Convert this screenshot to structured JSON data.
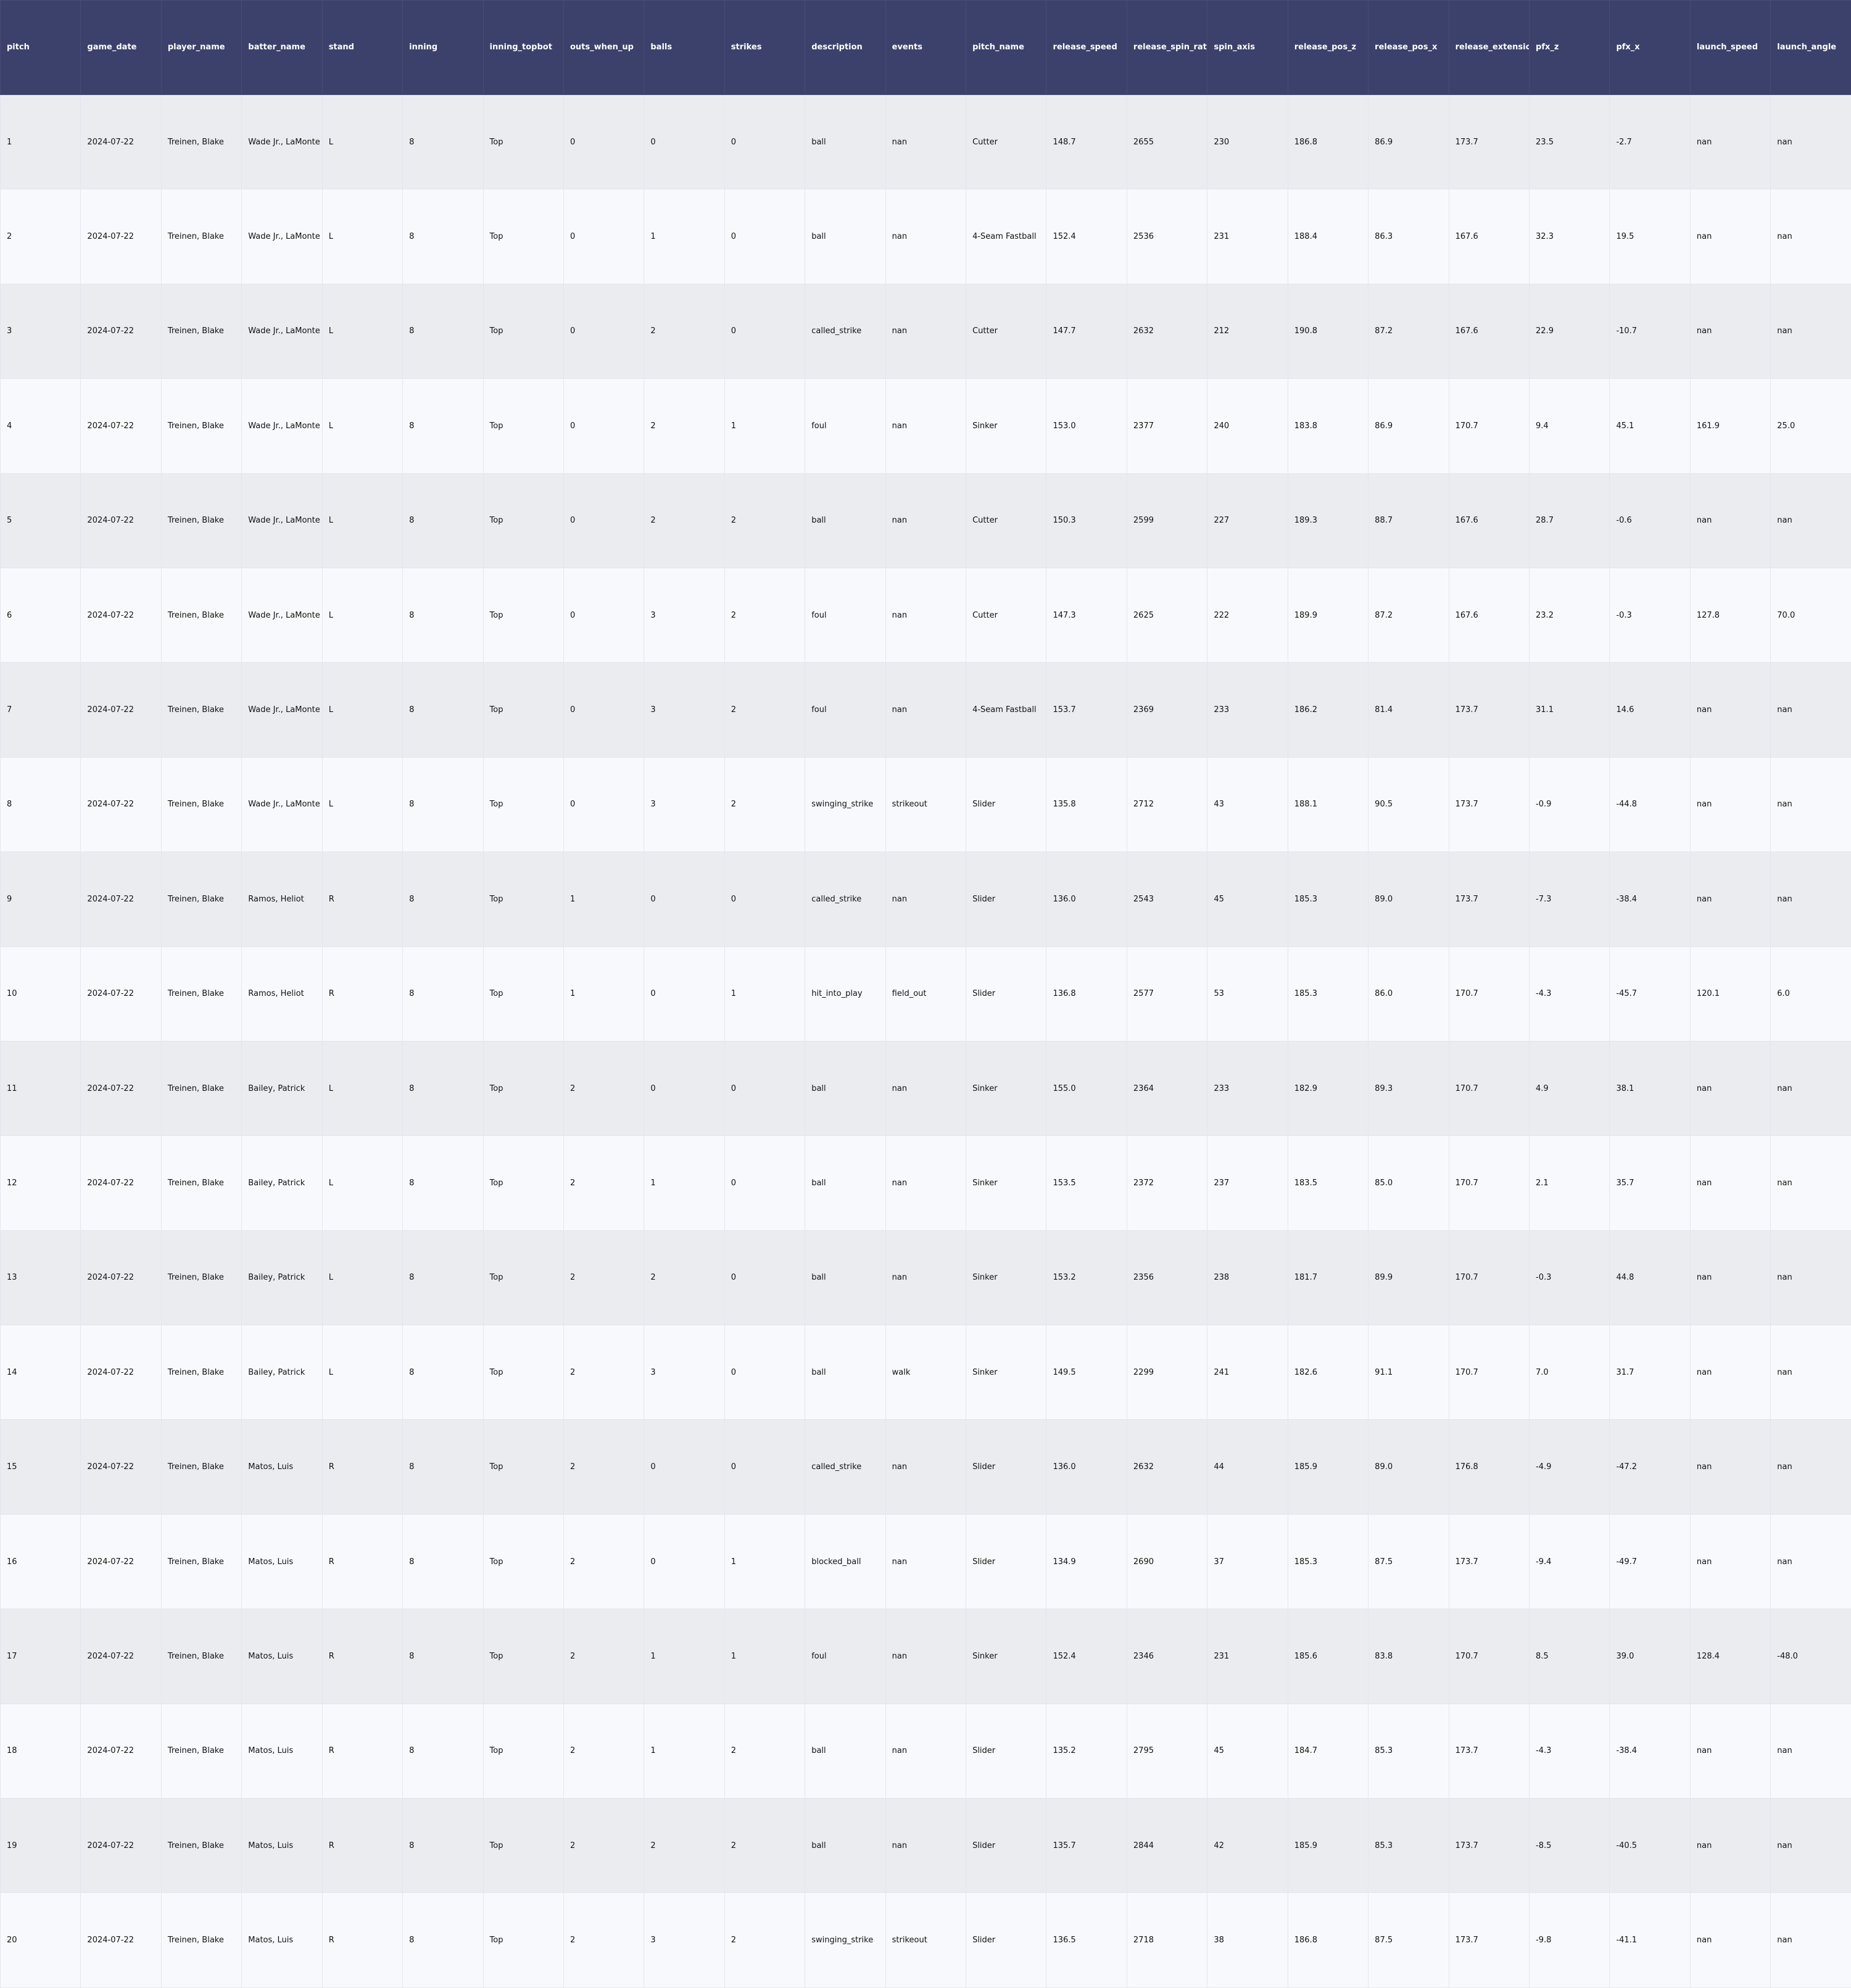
{
  "chart_data": {
    "type": "table",
    "columns": [
      "pitch",
      "game_date",
      "player_name",
      "batter_name",
      "stand",
      "inning",
      "inning_topbot",
      "outs_when_up",
      "balls",
      "strikes",
      "description",
      "events",
      "pitch_name",
      "release_speed",
      "release_spin_rate",
      "spin_axis",
      "release_pos_z",
      "release_pos_x",
      "release_extension",
      "pfx_z",
      "pfx_x",
      "launch_speed",
      "launch_angle"
    ],
    "rows": [
      [
        "1",
        "2024-07-22",
        "Treinen, Blake",
        "Wade Jr., LaMonte",
        "L",
        "8",
        "Top",
        "0",
        "0",
        "0",
        "ball",
        "nan",
        "Cutter",
        "148.7",
        "2655",
        "230",
        "186.8",
        "86.9",
        "173.7",
        "23.5",
        "-2.7",
        "nan",
        "nan"
      ],
      [
        "2",
        "2024-07-22",
        "Treinen, Blake",
        "Wade Jr., LaMonte",
        "L",
        "8",
        "Top",
        "0",
        "1",
        "0",
        "ball",
        "nan",
        "4-Seam Fastball",
        "152.4",
        "2536",
        "231",
        "188.4",
        "86.3",
        "167.6",
        "32.3",
        "19.5",
        "nan",
        "nan"
      ],
      [
        "3",
        "2024-07-22",
        "Treinen, Blake",
        "Wade Jr., LaMonte",
        "L",
        "8",
        "Top",
        "0",
        "2",
        "0",
        "called_strike",
        "nan",
        "Cutter",
        "147.7",
        "2632",
        "212",
        "190.8",
        "87.2",
        "167.6",
        "22.9",
        "-10.7",
        "nan",
        "nan"
      ],
      [
        "4",
        "2024-07-22",
        "Treinen, Blake",
        "Wade Jr., LaMonte",
        "L",
        "8",
        "Top",
        "0",
        "2",
        "1",
        "foul",
        "nan",
        "Sinker",
        "153.0",
        "2377",
        "240",
        "183.8",
        "86.9",
        "170.7",
        "9.4",
        "45.1",
        "161.9",
        "25.0"
      ],
      [
        "5",
        "2024-07-22",
        "Treinen, Blake",
        "Wade Jr., LaMonte",
        "L",
        "8",
        "Top",
        "0",
        "2",
        "2",
        "ball",
        "nan",
        "Cutter",
        "150.3",
        "2599",
        "227",
        "189.3",
        "88.7",
        "167.6",
        "28.7",
        "-0.6",
        "nan",
        "nan"
      ],
      [
        "6",
        "2024-07-22",
        "Treinen, Blake",
        "Wade Jr., LaMonte",
        "L",
        "8",
        "Top",
        "0",
        "3",
        "2",
        "foul",
        "nan",
        "Cutter",
        "147.3",
        "2625",
        "222",
        "189.9",
        "87.2",
        "167.6",
        "23.2",
        "-0.3",
        "127.8",
        "70.0"
      ],
      [
        "7",
        "2024-07-22",
        "Treinen, Blake",
        "Wade Jr., LaMonte",
        "L",
        "8",
        "Top",
        "0",
        "3",
        "2",
        "foul",
        "nan",
        "4-Seam Fastball",
        "153.7",
        "2369",
        "233",
        "186.2",
        "81.4",
        "173.7",
        "31.1",
        "14.6",
        "nan",
        "nan"
      ],
      [
        "8",
        "2024-07-22",
        "Treinen, Blake",
        "Wade Jr., LaMonte",
        "L",
        "8",
        "Top",
        "0",
        "3",
        "2",
        "swinging_strike",
        "strikeout",
        "Slider",
        "135.8",
        "2712",
        "43",
        "188.1",
        "90.5",
        "173.7",
        "-0.9",
        "-44.8",
        "nan",
        "nan"
      ],
      [
        "9",
        "2024-07-22",
        "Treinen, Blake",
        "Ramos, Heliot",
        "R",
        "8",
        "Top",
        "1",
        "0",
        "0",
        "called_strike",
        "nan",
        "Slider",
        "136.0",
        "2543",
        "45",
        "185.3",
        "89.0",
        "173.7",
        "-7.3",
        "-38.4",
        "nan",
        "nan"
      ],
      [
        "10",
        "2024-07-22",
        "Treinen, Blake",
        "Ramos, Heliot",
        "R",
        "8",
        "Top",
        "1",
        "0",
        "1",
        "hit_into_play",
        "field_out",
        "Slider",
        "136.8",
        "2577",
        "53",
        "185.3",
        "86.0",
        "170.7",
        "-4.3",
        "-45.7",
        "120.1",
        "6.0"
      ],
      [
        "11",
        "2024-07-22",
        "Treinen, Blake",
        "Bailey, Patrick",
        "L",
        "8",
        "Top",
        "2",
        "0",
        "0",
        "ball",
        "nan",
        "Sinker",
        "155.0",
        "2364",
        "233",
        "182.9",
        "89.3",
        "170.7",
        "4.9",
        "38.1",
        "nan",
        "nan"
      ],
      [
        "12",
        "2024-07-22",
        "Treinen, Blake",
        "Bailey, Patrick",
        "L",
        "8",
        "Top",
        "2",
        "1",
        "0",
        "ball",
        "nan",
        "Sinker",
        "153.5",
        "2372",
        "237",
        "183.5",
        "85.0",
        "170.7",
        "2.1",
        "35.7",
        "nan",
        "nan"
      ],
      [
        "13",
        "2024-07-22",
        "Treinen, Blake",
        "Bailey, Patrick",
        "L",
        "8",
        "Top",
        "2",
        "2",
        "0",
        "ball",
        "nan",
        "Sinker",
        "153.2",
        "2356",
        "238",
        "181.7",
        "89.9",
        "170.7",
        "-0.3",
        "44.8",
        "nan",
        "nan"
      ],
      [
        "14",
        "2024-07-22",
        "Treinen, Blake",
        "Bailey, Patrick",
        "L",
        "8",
        "Top",
        "2",
        "3",
        "0",
        "ball",
        "walk",
        "Sinker",
        "149.5",
        "2299",
        "241",
        "182.6",
        "91.1",
        "170.7",
        "7.0",
        "31.7",
        "nan",
        "nan"
      ],
      [
        "15",
        "2024-07-22",
        "Treinen, Blake",
        "Matos, Luis",
        "R",
        "8",
        "Top",
        "2",
        "0",
        "0",
        "called_strike",
        "nan",
        "Slider",
        "136.0",
        "2632",
        "44",
        "185.9",
        "89.0",
        "176.8",
        "-4.9",
        "-47.2",
        "nan",
        "nan"
      ],
      [
        "16",
        "2024-07-22",
        "Treinen, Blake",
        "Matos, Luis",
        "R",
        "8",
        "Top",
        "2",
        "0",
        "1",
        "blocked_ball",
        "nan",
        "Slider",
        "134.9",
        "2690",
        "37",
        "185.3",
        "87.5",
        "173.7",
        "-9.4",
        "-49.7",
        "nan",
        "nan"
      ],
      [
        "17",
        "2024-07-22",
        "Treinen, Blake",
        "Matos, Luis",
        "R",
        "8",
        "Top",
        "2",
        "1",
        "1",
        "foul",
        "nan",
        "Sinker",
        "152.4",
        "2346",
        "231",
        "185.6",
        "83.8",
        "170.7",
        "8.5",
        "39.0",
        "128.4",
        "-48.0"
      ],
      [
        "18",
        "2024-07-22",
        "Treinen, Blake",
        "Matos, Luis",
        "R",
        "8",
        "Top",
        "2",
        "1",
        "2",
        "ball",
        "nan",
        "Slider",
        "135.2",
        "2795",
        "45",
        "184.7",
        "85.3",
        "173.7",
        "-4.3",
        "-38.4",
        "nan",
        "nan"
      ],
      [
        "19",
        "2024-07-22",
        "Treinen, Blake",
        "Matos, Luis",
        "R",
        "8",
        "Top",
        "2",
        "2",
        "2",
        "ball",
        "nan",
        "Slider",
        "135.7",
        "2844",
        "42",
        "185.9",
        "85.3",
        "173.7",
        "-8.5",
        "-40.5",
        "nan",
        "nan"
      ],
      [
        "20",
        "2024-07-22",
        "Treinen, Blake",
        "Matos, Luis",
        "R",
        "8",
        "Top",
        "2",
        "3",
        "2",
        "swinging_strike",
        "strikeout",
        "Slider",
        "136.5",
        "2718",
        "38",
        "186.8",
        "87.5",
        "173.7",
        "-9.8",
        "-41.1",
        "nan",
        "nan"
      ]
    ]
  },
  "colors": {
    "header_bg": "#3b416b",
    "header_text": "#ffffff",
    "row_odd_bg": "#ebecf0",
    "row_even_bg": "#f8f9fc"
  }
}
